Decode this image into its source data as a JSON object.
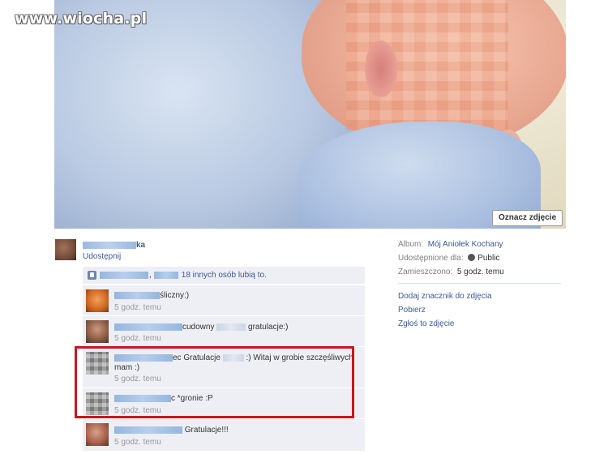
{
  "watermark": "www.wiocha.pl",
  "photo": {
    "tag_button": "Oznacz zdjęcie"
  },
  "uploader": {
    "name_suffix": "ka",
    "share": "Udostępnij"
  },
  "likes": {
    "separator": ",",
    "text": "18 innych osób lubią to."
  },
  "comments": [
    {
      "text": "śliczny:)",
      "time": "5 godz. temu"
    },
    {
      "text_a": "cudowny",
      "text_b": "gratulacje:)",
      "time": "5 godz. temu"
    },
    {
      "text_a": "ec Gratulacje",
      "text_b": ":) Witaj w grobie szczęśliwych mam :)",
      "time": "5 godz. temu"
    },
    {
      "text": "c *gronie :P",
      "time": "5 godz. temu"
    },
    {
      "text": "Gratulacje!!!",
      "time": "5 godz. temu"
    }
  ],
  "info": {
    "album_label": "Album:",
    "album_value": "Mój Aniołek Kochany",
    "shared_label": "Udostępnione dla:",
    "shared_value": "Public",
    "posted_label": "Zamieszczono:",
    "posted_value": "5 godz. temu"
  },
  "actions": [
    "Dodaj znacznik do zdjęcia",
    "Pobierz",
    "Zgłoś to zdjęcie"
  ]
}
